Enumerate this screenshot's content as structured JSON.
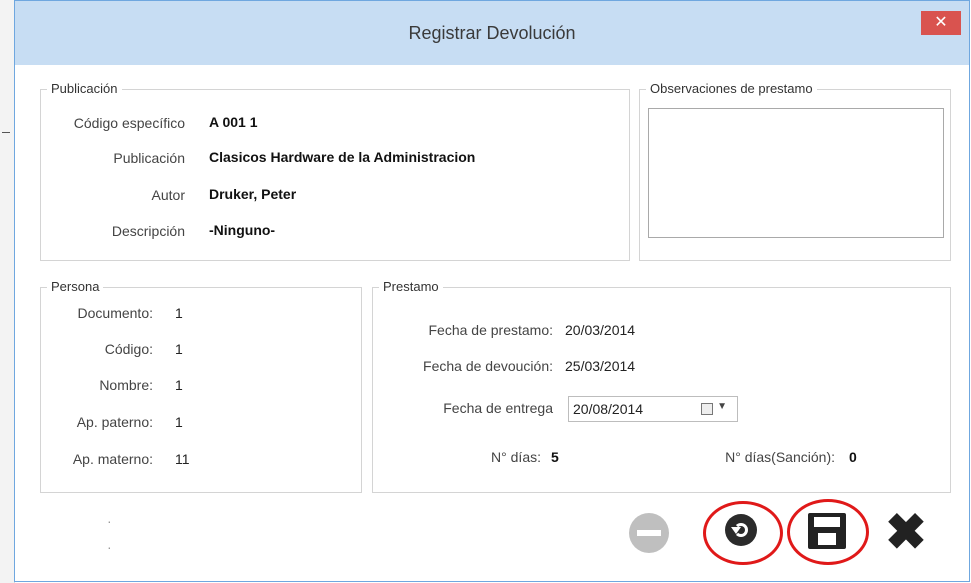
{
  "window": {
    "title": "Registrar Devolución",
    "close_glyph": "✕"
  },
  "publicacion": {
    "legend": "Publicación",
    "fields": [
      {
        "label": "Código específico",
        "value": "A 001 1"
      },
      {
        "label": "Publicación",
        "value": "Clasicos Hardware de la Administracion"
      },
      {
        "label": "Autor",
        "value": "Druker, Peter"
      },
      {
        "label": "Descripción",
        "value": "-Ninguno-"
      }
    ]
  },
  "observaciones": {
    "legend": "Observaciones de prestamo",
    "value": ""
  },
  "persona": {
    "legend": "Persona",
    "fields": [
      {
        "label": "Documento:",
        "value": "1"
      },
      {
        "label": "Código:",
        "value": "1"
      },
      {
        "label": "Nombre:",
        "value": "1"
      },
      {
        "label": "Ap. paterno:",
        "value": "1"
      },
      {
        "label": "Ap. materno:",
        "value": "11"
      }
    ]
  },
  "prestamo": {
    "legend": "Prestamo",
    "fecha_prestamo_label": "Fecha de prestamo:",
    "fecha_prestamo": "20/03/2014",
    "fecha_devolucion_label": "Fecha de devoución:",
    "fecha_devolucion": "25/03/2014",
    "fecha_entrega_label": "Fecha de entrega",
    "fecha_entrega": "20/08/2014",
    "dias_label": "N° días:",
    "dias": "5",
    "dias_sancion_label": "N° días(Sanción):",
    "dias_sancion": "0"
  },
  "toolbar": {
    "icons": [
      "stop-icon",
      "undo-icon",
      "save-icon",
      "close-icon"
    ],
    "highlight_color": "#e01919"
  },
  "colors": {
    "titlebar": "#c7ddf3",
    "close_button": "#d9534f"
  }
}
